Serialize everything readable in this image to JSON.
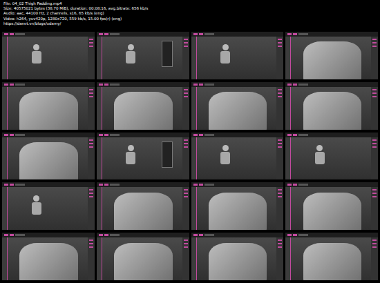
{
  "header": {
    "lines": [
      "File: 04_02 Thigh Padding.mp4",
      "Size: 40575021 bytes (38.70 MiB), duration: 00:08:16, avg.bitrate: 656 kb/s",
      "Audio: aac, 44100 Hz, 2 channels, s16, 65 kb/s (eng)",
      "Video: h264, yuv420p, 1280x720, 559 kb/s, 15.00 fps(r) (eng)",
      "https://danet.vn/blogs/udamy/"
    ]
  },
  "frames": [
    {
      "kind": "scene"
    },
    {
      "kind": "menu"
    },
    {
      "kind": "scene"
    },
    {
      "kind": "closeup"
    },
    {
      "kind": "closeup"
    },
    {
      "kind": "closeup"
    },
    {
      "kind": "closeup"
    },
    {
      "kind": "closeup"
    },
    {
      "kind": "closeup"
    },
    {
      "kind": "menu"
    },
    {
      "kind": "scene"
    },
    {
      "kind": "scene"
    },
    {
      "kind": "scene"
    },
    {
      "kind": "closeup"
    },
    {
      "kind": "closeup"
    },
    {
      "kind": "closeup"
    },
    {
      "kind": "closeup"
    },
    {
      "kind": "closeup"
    },
    {
      "kind": "closeup"
    },
    {
      "kind": "closeup"
    }
  ]
}
